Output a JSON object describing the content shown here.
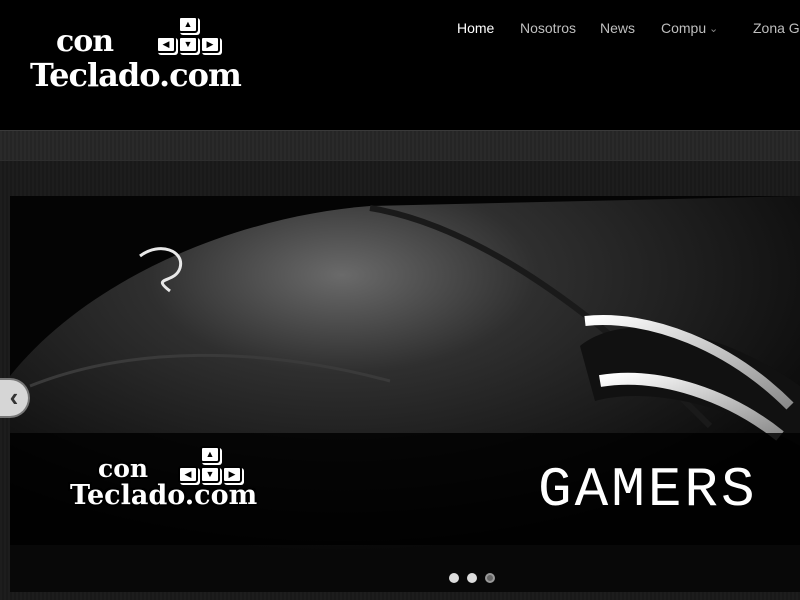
{
  "brand": {
    "logo_line1": "con",
    "logo_line2": "Teclado.com",
    "key_glyphs": [
      "▲",
      "◀",
      "▼",
      "▶"
    ]
  },
  "nav": {
    "items": [
      {
        "label": "Home",
        "active": true
      },
      {
        "label": "Nosotros",
        "active": false
      },
      {
        "label": "News",
        "active": false
      },
      {
        "label": "Compu",
        "active": false,
        "has_dropdown": true
      },
      {
        "label": "Zona Ge",
        "active": false
      }
    ],
    "dropdown_icon": "chevron-down-icon"
  },
  "slider": {
    "caption_logo_line1": "con",
    "caption_logo_line2": "Teclado.com",
    "caption_title": "GAMERS",
    "prev_icon": "chevron-left-icon",
    "prev_glyph": "‹",
    "dots": [
      {
        "active": true
      },
      {
        "active": true
      },
      {
        "active": false
      }
    ]
  },
  "colors": {
    "background": "#000000",
    "nav_active": "#ffffff",
    "nav_inactive": "#bfbfbf"
  }
}
